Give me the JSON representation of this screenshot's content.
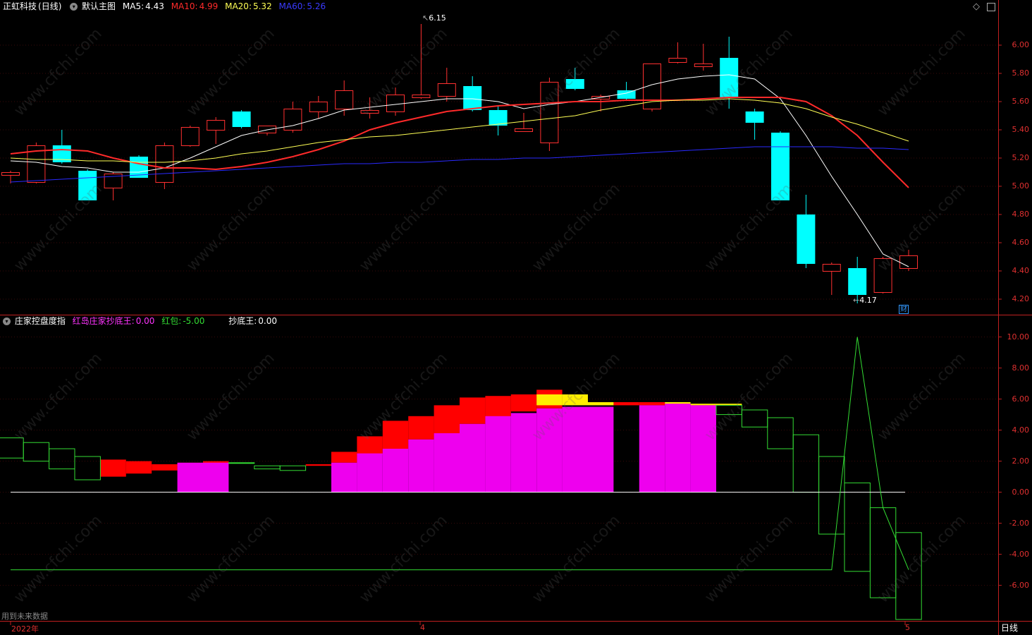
{
  "header": {
    "stock_name": "正虹科技",
    "period_tag": "(日线)",
    "view_label": "默认主图",
    "ma5_label": "MA5:",
    "ma5_value": "4.43",
    "ma5_color": "#ffffff",
    "ma10_label": "MA10:",
    "ma10_value": "4.99",
    "ma10_color": "#ff2a2a",
    "ma20_label": "MA20:",
    "ma20_value": "5.32",
    "ma20_color": "#ffff55",
    "ma60_label": "MA60:",
    "ma60_value": "5.26",
    "ma60_color": "#3a3aff"
  },
  "sub_header": {
    "indicator_name": "庄家控盘度指",
    "item1_label": "红岛庄家抄底王:",
    "item1_value": "0.00",
    "item1_color": "#ff33ff",
    "item2_label": "红包:",
    "item2_value": "-5.00",
    "item2_color": "#33dd33",
    "item3_label": "抄底王:",
    "item3_value": "0.00",
    "item3_color": "#ffffff"
  },
  "footer": {
    "note": "用到未来数据",
    "year_label": "2022年",
    "month_apr": "4",
    "month_may": "5",
    "period_button": "日线"
  },
  "watermark": "www.cfchi.com",
  "annotations": {
    "high": "6.15",
    "low": "4.17",
    "badge": "财"
  },
  "chart_data": [
    {
      "type": "candlestick",
      "title": "正虹科技 (日线)",
      "ylim": [
        4.12,
        6.22
      ],
      "yticks": [
        "6.00",
        "5.80",
        "5.60",
        "5.40",
        "5.20",
        "5.00",
        "4.80",
        "4.60",
        "4.40",
        "4.20"
      ],
      "up_color": "#ff3030",
      "down_color": "#00ffff",
      "candles": [
        {
          "o": 5.08,
          "h": 5.11,
          "l": 5.02,
          "c": 5.1
        },
        {
          "o": 5.03,
          "h": 5.31,
          "l": 5.02,
          "c": 5.29
        },
        {
          "o": 5.29,
          "h": 5.4,
          "l": 5.16,
          "c": 5.17
        },
        {
          "o": 5.11,
          "h": 5.12,
          "l": 4.9,
          "c": 4.9
        },
        {
          "o": 4.99,
          "h": 5.1,
          "l": 4.9,
          "c": 5.09
        },
        {
          "o": 5.21,
          "h": 5.22,
          "l": 5.06,
          "c": 5.06
        },
        {
          "o": 5.03,
          "h": 5.31,
          "l": 4.98,
          "c": 5.29
        },
        {
          "o": 5.29,
          "h": 5.43,
          "l": 5.28,
          "c": 5.42
        },
        {
          "o": 5.4,
          "h": 5.49,
          "l": 5.3,
          "c": 5.47
        },
        {
          "o": 5.53,
          "h": 5.54,
          "l": 5.41,
          "c": 5.42
        },
        {
          "o": 5.38,
          "h": 5.43,
          "l": 5.36,
          "c": 5.43
        },
        {
          "o": 5.4,
          "h": 5.6,
          "l": 5.38,
          "c": 5.55
        },
        {
          "o": 5.53,
          "h": 5.64,
          "l": 5.48,
          "c": 5.6
        },
        {
          "o": 5.55,
          "h": 5.75,
          "l": 5.5,
          "c": 5.68
        },
        {
          "o": 5.52,
          "h": 5.63,
          "l": 5.48,
          "c": 5.54
        },
        {
          "o": 5.53,
          "h": 5.7,
          "l": 5.5,
          "c": 5.65
        },
        {
          "o": 5.63,
          "h": 6.15,
          "l": 5.62,
          "c": 5.65
        },
        {
          "o": 5.64,
          "h": 5.84,
          "l": 5.6,
          "c": 5.73
        },
        {
          "o": 5.71,
          "h": 5.78,
          "l": 5.53,
          "c": 5.54
        },
        {
          "o": 5.54,
          "h": 5.57,
          "l": 5.36,
          "c": 5.43
        },
        {
          "o": 5.39,
          "h": 5.52,
          "l": 5.39,
          "c": 5.41
        },
        {
          "o": 5.31,
          "h": 5.77,
          "l": 5.25,
          "c": 5.74
        },
        {
          "o": 5.76,
          "h": 5.84,
          "l": 5.68,
          "c": 5.69
        },
        {
          "o": 5.62,
          "h": 5.65,
          "l": 5.53,
          "c": 5.64
        },
        {
          "o": 5.68,
          "h": 5.74,
          "l": 5.61,
          "c": 5.62
        },
        {
          "o": 5.55,
          "h": 5.87,
          "l": 5.53,
          "c": 5.87
        },
        {
          "o": 5.88,
          "h": 6.02,
          "l": 5.87,
          "c": 5.91
        },
        {
          "o": 5.85,
          "h": 6.01,
          "l": 5.82,
          "c": 5.87
        },
        {
          "o": 5.91,
          "h": 6.06,
          "l": 5.55,
          "c": 5.63
        },
        {
          "o": 5.53,
          "h": 5.55,
          "l": 5.33,
          "c": 5.45
        },
        {
          "o": 5.38,
          "h": 5.39,
          "l": 4.9,
          "c": 4.9
        },
        {
          "o": 4.8,
          "h": 4.94,
          "l": 4.42,
          "c": 4.45
        },
        {
          "o": 4.4,
          "h": 4.46,
          "l": 4.23,
          "c": 4.45
        },
        {
          "o": 4.42,
          "h": 4.5,
          "l": 4.17,
          "c": 4.23
        },
        {
          "o": 4.25,
          "h": 4.5,
          "l": 4.24,
          "c": 4.49
        },
        {
          "o": 4.42,
          "h": 4.55,
          "l": 4.4,
          "c": 4.51
        }
      ],
      "series": [
        {
          "name": "MA5",
          "color": "#ffffff",
          "values": [
            5.18,
            5.17,
            5.14,
            5.13,
            5.1,
            5.1,
            5.13,
            5.2,
            5.28,
            5.36,
            5.4,
            5.43,
            5.48,
            5.54,
            5.56,
            5.58,
            5.6,
            5.62,
            5.62,
            5.6,
            5.55,
            5.58,
            5.6,
            5.63,
            5.66,
            5.72,
            5.76,
            5.78,
            5.79,
            5.76,
            5.62,
            5.36,
            5.07,
            4.8,
            4.52,
            4.43
          ]
        },
        {
          "name": "MA10",
          "color": "#ff2a2a",
          "values": [
            5.23,
            5.25,
            5.26,
            5.25,
            5.2,
            5.16,
            5.13,
            5.13,
            5.12,
            5.14,
            5.17,
            5.21,
            5.26,
            5.32,
            5.4,
            5.45,
            5.49,
            5.53,
            5.55,
            5.57,
            5.58,
            5.59,
            5.6,
            5.6,
            5.61,
            5.61,
            5.61,
            5.62,
            5.63,
            5.63,
            5.63,
            5.6,
            5.5,
            5.36,
            5.17,
            4.99
          ]
        },
        {
          "name": "MA20",
          "color": "#ffff55",
          "values": [
            5.2,
            5.19,
            5.19,
            5.18,
            5.18,
            5.17,
            5.17,
            5.18,
            5.2,
            5.23,
            5.25,
            5.28,
            5.31,
            5.33,
            5.35,
            5.36,
            5.38,
            5.4,
            5.42,
            5.44,
            5.46,
            5.48,
            5.5,
            5.54,
            5.57,
            5.6,
            5.61,
            5.61,
            5.62,
            5.61,
            5.59,
            5.55,
            5.49,
            5.44,
            5.38,
            5.32
          ]
        },
        {
          "name": "MA60",
          "color": "#2a2aff",
          "values": [
            5.03,
            5.04,
            5.05,
            5.06,
            5.07,
            5.08,
            5.09,
            5.1,
            5.11,
            5.12,
            5.13,
            5.14,
            5.15,
            5.16,
            5.16,
            5.17,
            5.17,
            5.18,
            5.19,
            5.19,
            5.2,
            5.2,
            5.21,
            5.22,
            5.23,
            5.24,
            5.25,
            5.26,
            5.27,
            5.28,
            5.28,
            5.28,
            5.28,
            5.27,
            5.27,
            5.26
          ]
        }
      ]
    },
    {
      "type": "bar",
      "title": "庄家控盘度指",
      "ylim": [
        -8.2,
        10.8
      ],
      "yticks": [
        "10.00",
        "8.00",
        "6.00",
        "4.00",
        "2.00",
        "0.00",
        "-2.00",
        "-4.00",
        "-6.00"
      ],
      "outline_boxes": [
        {
          "i": 0,
          "a": 3.5,
          "b": 2.2
        },
        {
          "i": 1,
          "a": 3.2,
          "b": 2.0
        },
        {
          "i": 2,
          "a": 2.8,
          "b": 1.5
        },
        {
          "i": 3,
          "a": 2.3,
          "b": 0.8
        },
        {
          "i": 9,
          "a": 1.9,
          "b": 1.9
        },
        {
          "i": 10,
          "a": 1.7,
          "b": 1.5
        },
        {
          "i": 11,
          "a": 1.7,
          "b": 1.4
        },
        {
          "i": 28,
          "a": 5.6,
          "b": 5.0
        },
        {
          "i": 29,
          "a": 5.3,
          "b": 4.2
        },
        {
          "i": 30,
          "a": 4.8,
          "b": 2.8
        },
        {
          "i": 31,
          "a": 3.7,
          "b": 0.0
        },
        {
          "i": 32,
          "a": 2.3,
          "b": -2.7
        },
        {
          "i": 33,
          "a": 0.6,
          "b": -5.1
        },
        {
          "i": 34,
          "a": -1.0,
          "b": -6.8
        },
        {
          "i": 35,
          "a": -2.6,
          "b": -8.2
        }
      ],
      "red_blocks": [
        {
          "i": 4,
          "a": 2.1,
          "b": 1.0
        },
        {
          "i": 5,
          "a": 2.0,
          "b": 1.2
        },
        {
          "i": 6,
          "a": 1.8,
          "b": 1.4
        },
        {
          "i": 7,
          "a": 1.9,
          "b": 1.7
        },
        {
          "i": 8,
          "a": 2.0,
          "b": 1.8
        },
        {
          "i": 12,
          "a": 1.8,
          "b": 1.7
        },
        {
          "i": 13,
          "a": 2.6,
          "b": 1.9
        },
        {
          "i": 14,
          "a": 3.6,
          "b": 2.4
        },
        {
          "i": 15,
          "a": 4.6,
          "b": 2.8
        },
        {
          "i": 16,
          "a": 4.9,
          "b": 3.4
        },
        {
          "i": 17,
          "a": 5.6,
          "b": 3.8
        },
        {
          "i": 18,
          "a": 6.1,
          "b": 4.4
        },
        {
          "i": 19,
          "a": 6.2,
          "b": 4.8
        },
        {
          "i": 20,
          "a": 6.3,
          "b": 5.2
        },
        {
          "i": 21,
          "a": 6.6,
          "b": 5.4
        },
        {
          "i": 24,
          "a": 5.8,
          "b": 5.6
        },
        {
          "i": 25,
          "a": 5.8,
          "b": 5.6
        },
        {
          "i": 26,
          "a": 5.7,
          "b": 5.6
        }
      ],
      "yellow_blocks": [
        {
          "i": 21,
          "a": 6.3,
          "b": 5.6
        },
        {
          "i": 22,
          "a": 6.3,
          "b": 5.6
        },
        {
          "i": 23,
          "a": 5.8,
          "b": 5.6
        },
        {
          "i": 26,
          "a": 5.8,
          "b": 5.7
        },
        {
          "i": 27,
          "a": 5.7,
          "b": 5.6
        },
        {
          "i": 28,
          "a": 5.7,
          "b": 5.6
        }
      ],
      "magenta_blocks": [
        {
          "i": 7,
          "a": 1.9,
          "b": 0.0
        },
        {
          "i": 8,
          "a": 1.9,
          "b": 0.0
        },
        {
          "i": 13,
          "a": 1.9,
          "b": 0.0
        },
        {
          "i": 14,
          "a": 2.5,
          "b": 0.0
        },
        {
          "i": 15,
          "a": 2.8,
          "b": 0.0
        },
        {
          "i": 16,
          "a": 3.4,
          "b": 0.0
        },
        {
          "i": 17,
          "a": 3.8,
          "b": 0.0
        },
        {
          "i": 18,
          "a": 4.4,
          "b": 0.0
        },
        {
          "i": 19,
          "a": 4.9,
          "b": 0.0
        },
        {
          "i": 20,
          "a": 5.1,
          "b": 0.0
        },
        {
          "i": 21,
          "a": 5.4,
          "b": 0.0
        },
        {
          "i": 22,
          "a": 5.5,
          "b": 0.0
        },
        {
          "i": 23,
          "a": 5.5,
          "b": 0.0
        },
        {
          "i": 25,
          "a": 5.6,
          "b": 0.0
        },
        {
          "i": 26,
          "a": 5.7,
          "b": 0.0
        },
        {
          "i": 27,
          "a": 5.6,
          "b": 0.0
        }
      ],
      "green_line": {
        "color": "#33dd33",
        "values": [
          -5.0,
          -5.0,
          -5.0,
          -5.0,
          -5.0,
          -5.0,
          -5.0,
          -5.0,
          -5.0,
          -5.0,
          -5.0,
          -5.0,
          -5.0,
          -5.0,
          -5.0,
          -5.0,
          -5.0,
          -5.0,
          -5.0,
          -5.0,
          -5.0,
          -5.0,
          -5.0,
          -5.0,
          -5.0,
          -5.0,
          -5.0,
          -5.0,
          -5.0,
          -5.0,
          -5.0,
          -5.0,
          -5.0,
          10.0,
          -1.0,
          -5.0
        ]
      }
    }
  ]
}
